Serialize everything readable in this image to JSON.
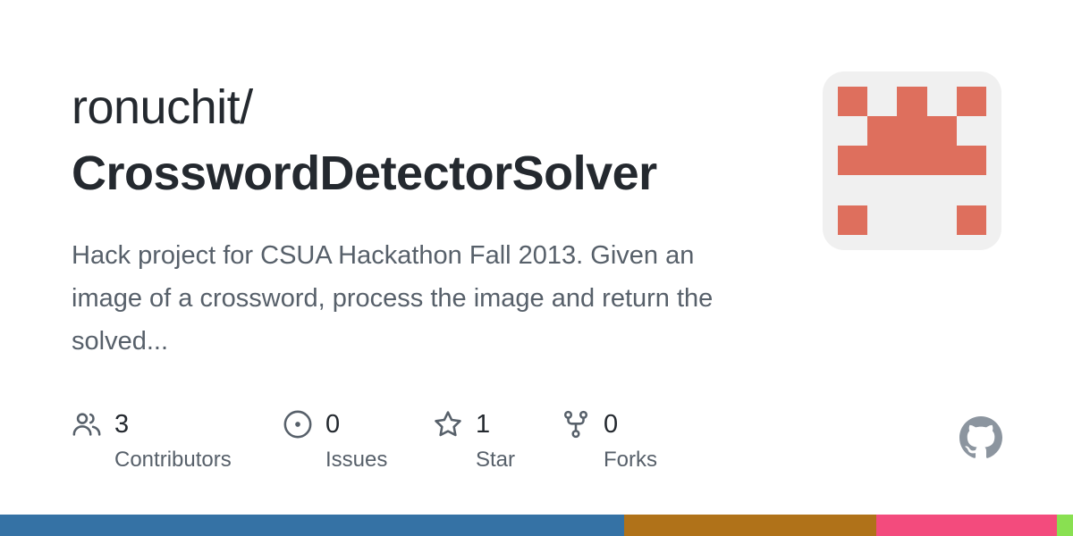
{
  "repo": {
    "owner": "ronuchit/",
    "name": "CrosswordDetectorSolver",
    "description": "Hack project for CSUA Hackathon Fall 2013. Given an image of a crossword, process the image and return the solved..."
  },
  "avatar": {
    "icon": "identicon",
    "color": "#de6f5d",
    "background": "#f0f0f0"
  },
  "stats": [
    {
      "icon": "people-icon",
      "value": "3",
      "label": "Contributors"
    },
    {
      "icon": "issue-opened-icon",
      "value": "0",
      "label": "Issues"
    },
    {
      "icon": "star-icon",
      "value": "1",
      "label": "Star"
    },
    {
      "icon": "repo-forked-icon",
      "value": "0",
      "label": "Forks"
    }
  ],
  "brand_icon": "github-mark-icon",
  "language_bar": [
    {
      "color": "#3572a5",
      "fraction": 0.582
    },
    {
      "color": "#b07219",
      "fraction": 0.235
    },
    {
      "color": "#f34b7d",
      "fraction": 0.168
    },
    {
      "color": "#89e051",
      "fraction": 0.015
    }
  ],
  "colors": {
    "title": "#24292f",
    "muted": "#57606a"
  }
}
